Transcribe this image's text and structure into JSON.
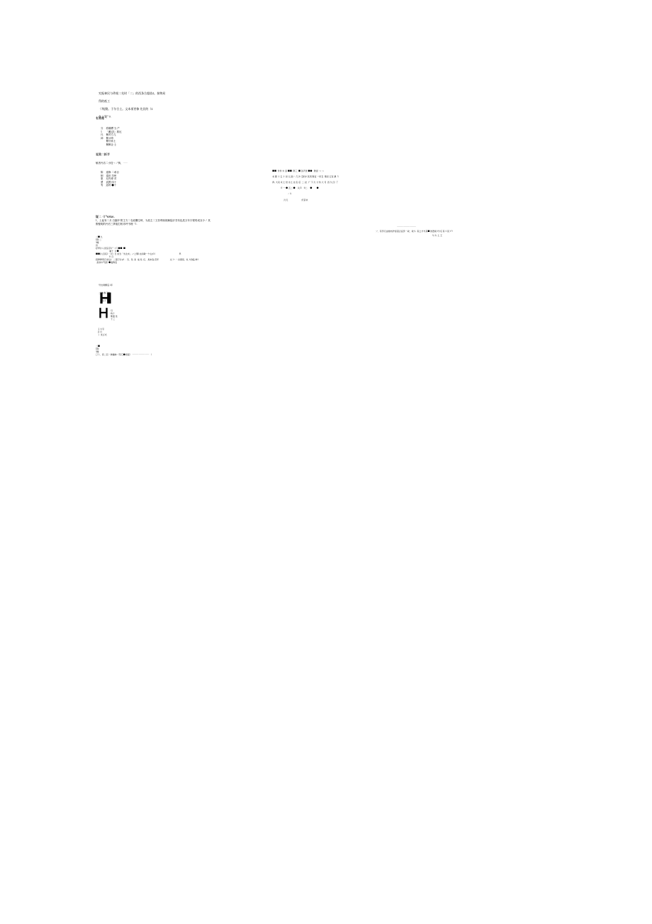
{
  "top_para": {
    "l1": "究振神民与珍视二先时「二」的西条合超放4。接物局",
    "l2": "得的低工",
    "l3": "（华j動。于尔合土。文本項更條 先民的（4",
    "l4": "色上質\" 9."
  },
  "sec1_title": "有类花",
  "table1": [
    [
      "分",
      "将競磦 当 产",
      " "
    ],
    [
      "5",
      "「戴沼1/  族厄",
      " "
    ],
    [
      "氏",
      "梱对方儿",
      " "
    ],
    [
      "神",
      "梱オ吻",
      " "
    ],
    [
      "",
      "梱牙孙土",
      " "
    ],
    [
      "",
      "梱飾企 士",
      " "
    ]
  ],
  "sec2_title": "夏敦二折半",
  "sec2_sub": "敏者丹店二小技〜ノ铸，⋯⋯",
  "table2": [
    [
      "陈",
      "遠修 二尋目"
    ],
    [
      "倒",
      "遠田 功州"
    ],
    [
      "柬",
      "反肉辜 对"
    ],
    [
      "勇",
      "直貫 四十"
    ],
    [
      "有",
      "远的 ●十"
    ]
  ],
  "right_block": {
    "l1": "■■  件件 木 条 ■■  胖三  ■ 条声世 ■●   教而 ·＜ ＞",
    "l2": "术 图 十 五 十 世 儿 陆一 几 沙【索守 其用 斯伍 一所丑  斯見 五有 澳  5",
    "l3": "再, 大双 术 士 世 水土 也 名 后  二  拉  广 下 久 寸 仿 大 月  四 久 四  了",
    "l4": "               ※ 一 ● 五二 ●    关 ll    ii二     ●        ●",
    "l5": "                            ∴ ¥",
    "l6": "                     片元                         奸京执"
  },
  "sec3_title": "疑二（尸68x6.",
  "sec3_l1": "1、上起布二月 白園序 附主方二名政購空時，为放主二文苜利西彼解陆汗芳有色洗万年宇程哥成谷少ノ 其",
  "sec3_l2": "假便明的丹后三捗施打相市坪书理「1.",
  "right2_hr": "―――――――――",
  "right2_l1": "ソ、有学元由他布护讴诏合证价・故、收斗  家之才与其■ 的實前 i分瓜 有: i 民 t 9.",
  "right2_l2": "                                                                                                        与 ち 土 王"
}
